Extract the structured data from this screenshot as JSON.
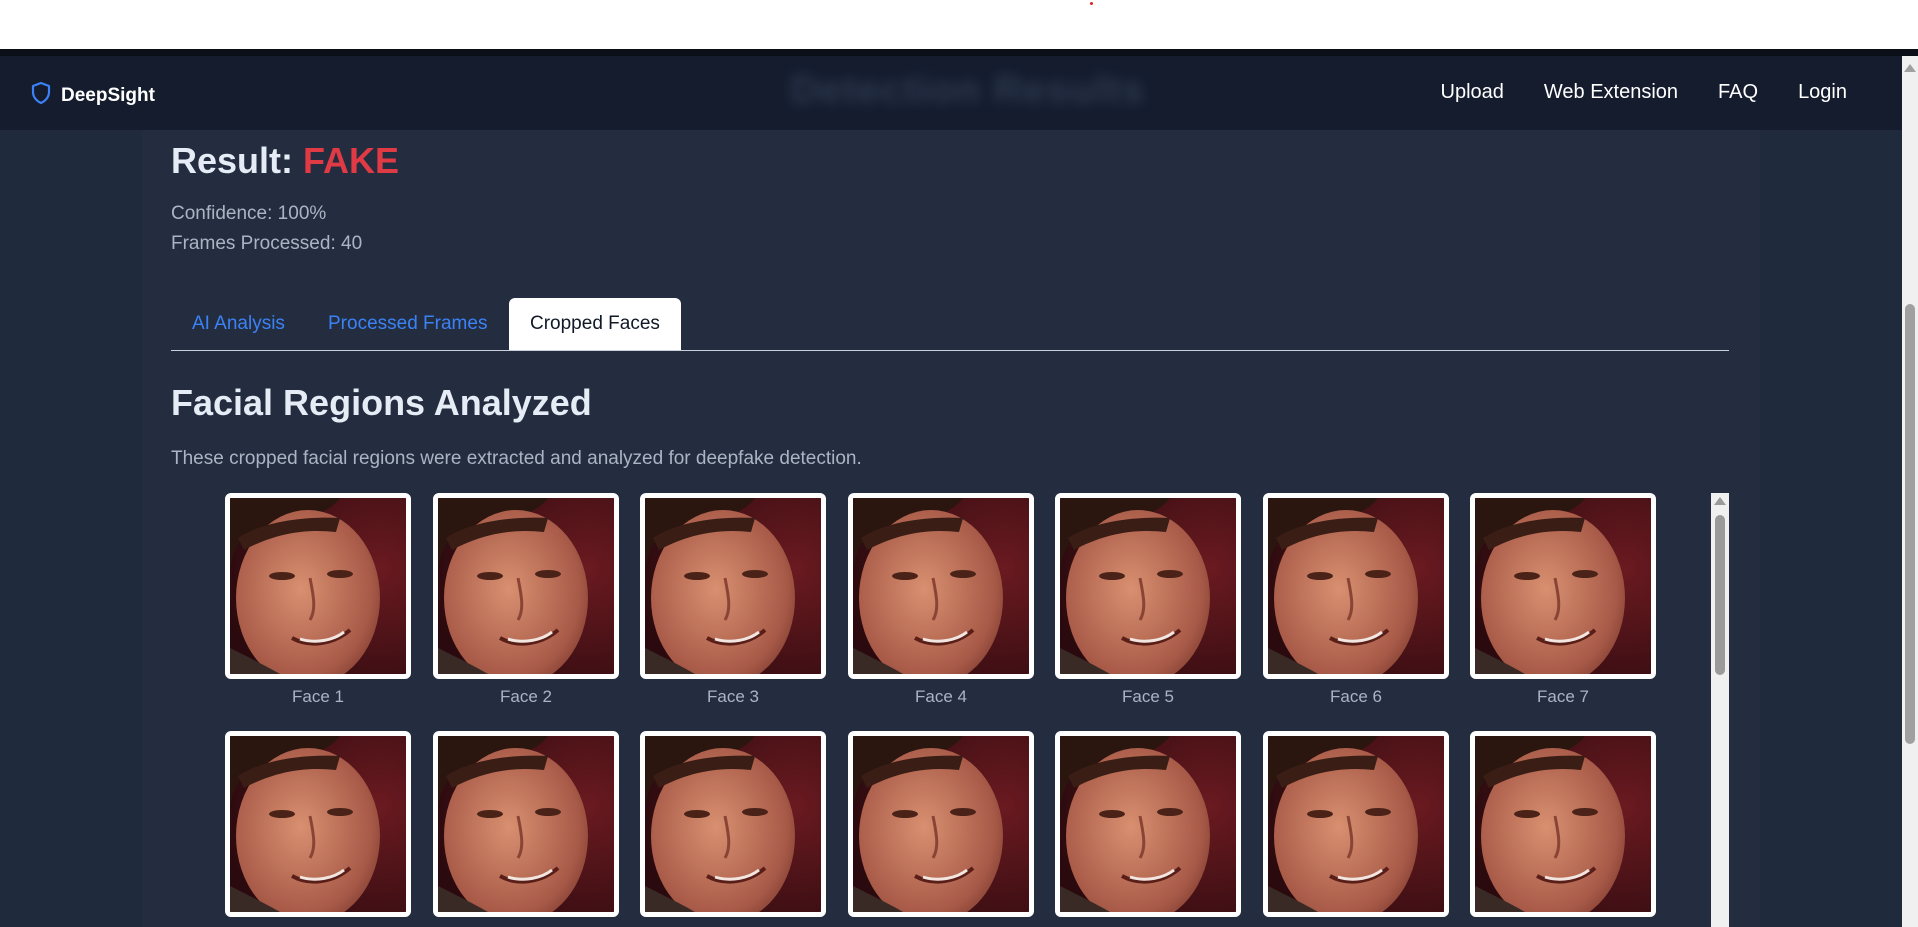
{
  "brand": {
    "name": "DeepSight",
    "icon": "shield-icon",
    "icon_color": "#3b82f6"
  },
  "header": {
    "ghost_title": "Detection Results"
  },
  "nav": [
    {
      "label": "Upload"
    },
    {
      "label": "Web Extension"
    },
    {
      "label": "FAQ"
    },
    {
      "label": "Login"
    }
  ],
  "result": {
    "prefix": "Result: ",
    "verdict": "FAKE",
    "verdict_color": "#e03a45",
    "confidence": "Confidence: 100%",
    "frames": "Frames Processed: 40"
  },
  "tabs": [
    {
      "label": "AI Analysis",
      "active": false
    },
    {
      "label": "Processed Frames",
      "active": false
    },
    {
      "label": "Cropped Faces",
      "active": true
    }
  ],
  "section": {
    "title": "Facial Regions Analyzed",
    "description": "These cropped facial regions were extracted and analyzed for deepfake detection."
  },
  "faces": [
    {
      "label": "Face 1"
    },
    {
      "label": "Face 2"
    },
    {
      "label": "Face 3"
    },
    {
      "label": "Face 4"
    },
    {
      "label": "Face 5"
    },
    {
      "label": "Face 6"
    },
    {
      "label": "Face 7"
    },
    {
      "label": ""
    },
    {
      "label": ""
    },
    {
      "label": ""
    },
    {
      "label": ""
    },
    {
      "label": ""
    },
    {
      "label": ""
    },
    {
      "label": ""
    }
  ]
}
